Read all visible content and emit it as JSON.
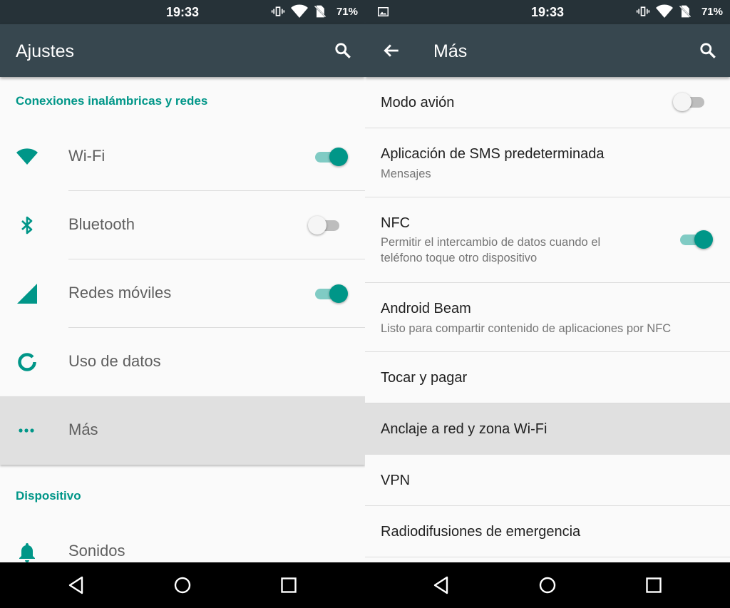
{
  "status_bar": {
    "time": "19:33",
    "battery": "71%"
  },
  "left": {
    "title": "Ajustes",
    "section_wireless": "Conexiones inalámbricas y redes",
    "items": [
      {
        "label": "Wi-Fi",
        "icon": "wifi-icon",
        "switch": "on"
      },
      {
        "label": "Bluetooth",
        "icon": "bluetooth-icon",
        "switch": "off"
      },
      {
        "label": "Redes móviles",
        "icon": "signal-icon",
        "switch": "on"
      },
      {
        "label": "Uso de datos",
        "icon": "data-usage-icon"
      },
      {
        "label": "Más",
        "icon": "more-icon",
        "highlighted": true
      }
    ],
    "section_device": "Dispositivo",
    "device_items": [
      {
        "label": "Sonidos",
        "icon": "bell-icon"
      }
    ]
  },
  "right": {
    "title": "Más",
    "items": [
      {
        "title": "Modo avión",
        "switch": "off"
      },
      {
        "title": "Aplicación de SMS predeterminada",
        "subtitle": "Mensajes"
      },
      {
        "title": "NFC",
        "subtitle": "Permitir el intercambio de datos cuando el teléfono toque otro dispositivo",
        "switch": "on"
      },
      {
        "title": "Android Beam",
        "subtitle": "Listo para compartir contenido de aplicaciones por NFC"
      },
      {
        "title": "Tocar y pagar"
      },
      {
        "title": "Anclaje a red y zona Wi-Fi",
        "highlighted": true
      },
      {
        "title": "VPN"
      },
      {
        "title": "Radiodifusiones de emergencia"
      }
    ]
  },
  "colors": {
    "accent": "#009688",
    "toolbar": "#37474f",
    "statusbar": "#263238",
    "highlight": "#e0e0e0"
  }
}
